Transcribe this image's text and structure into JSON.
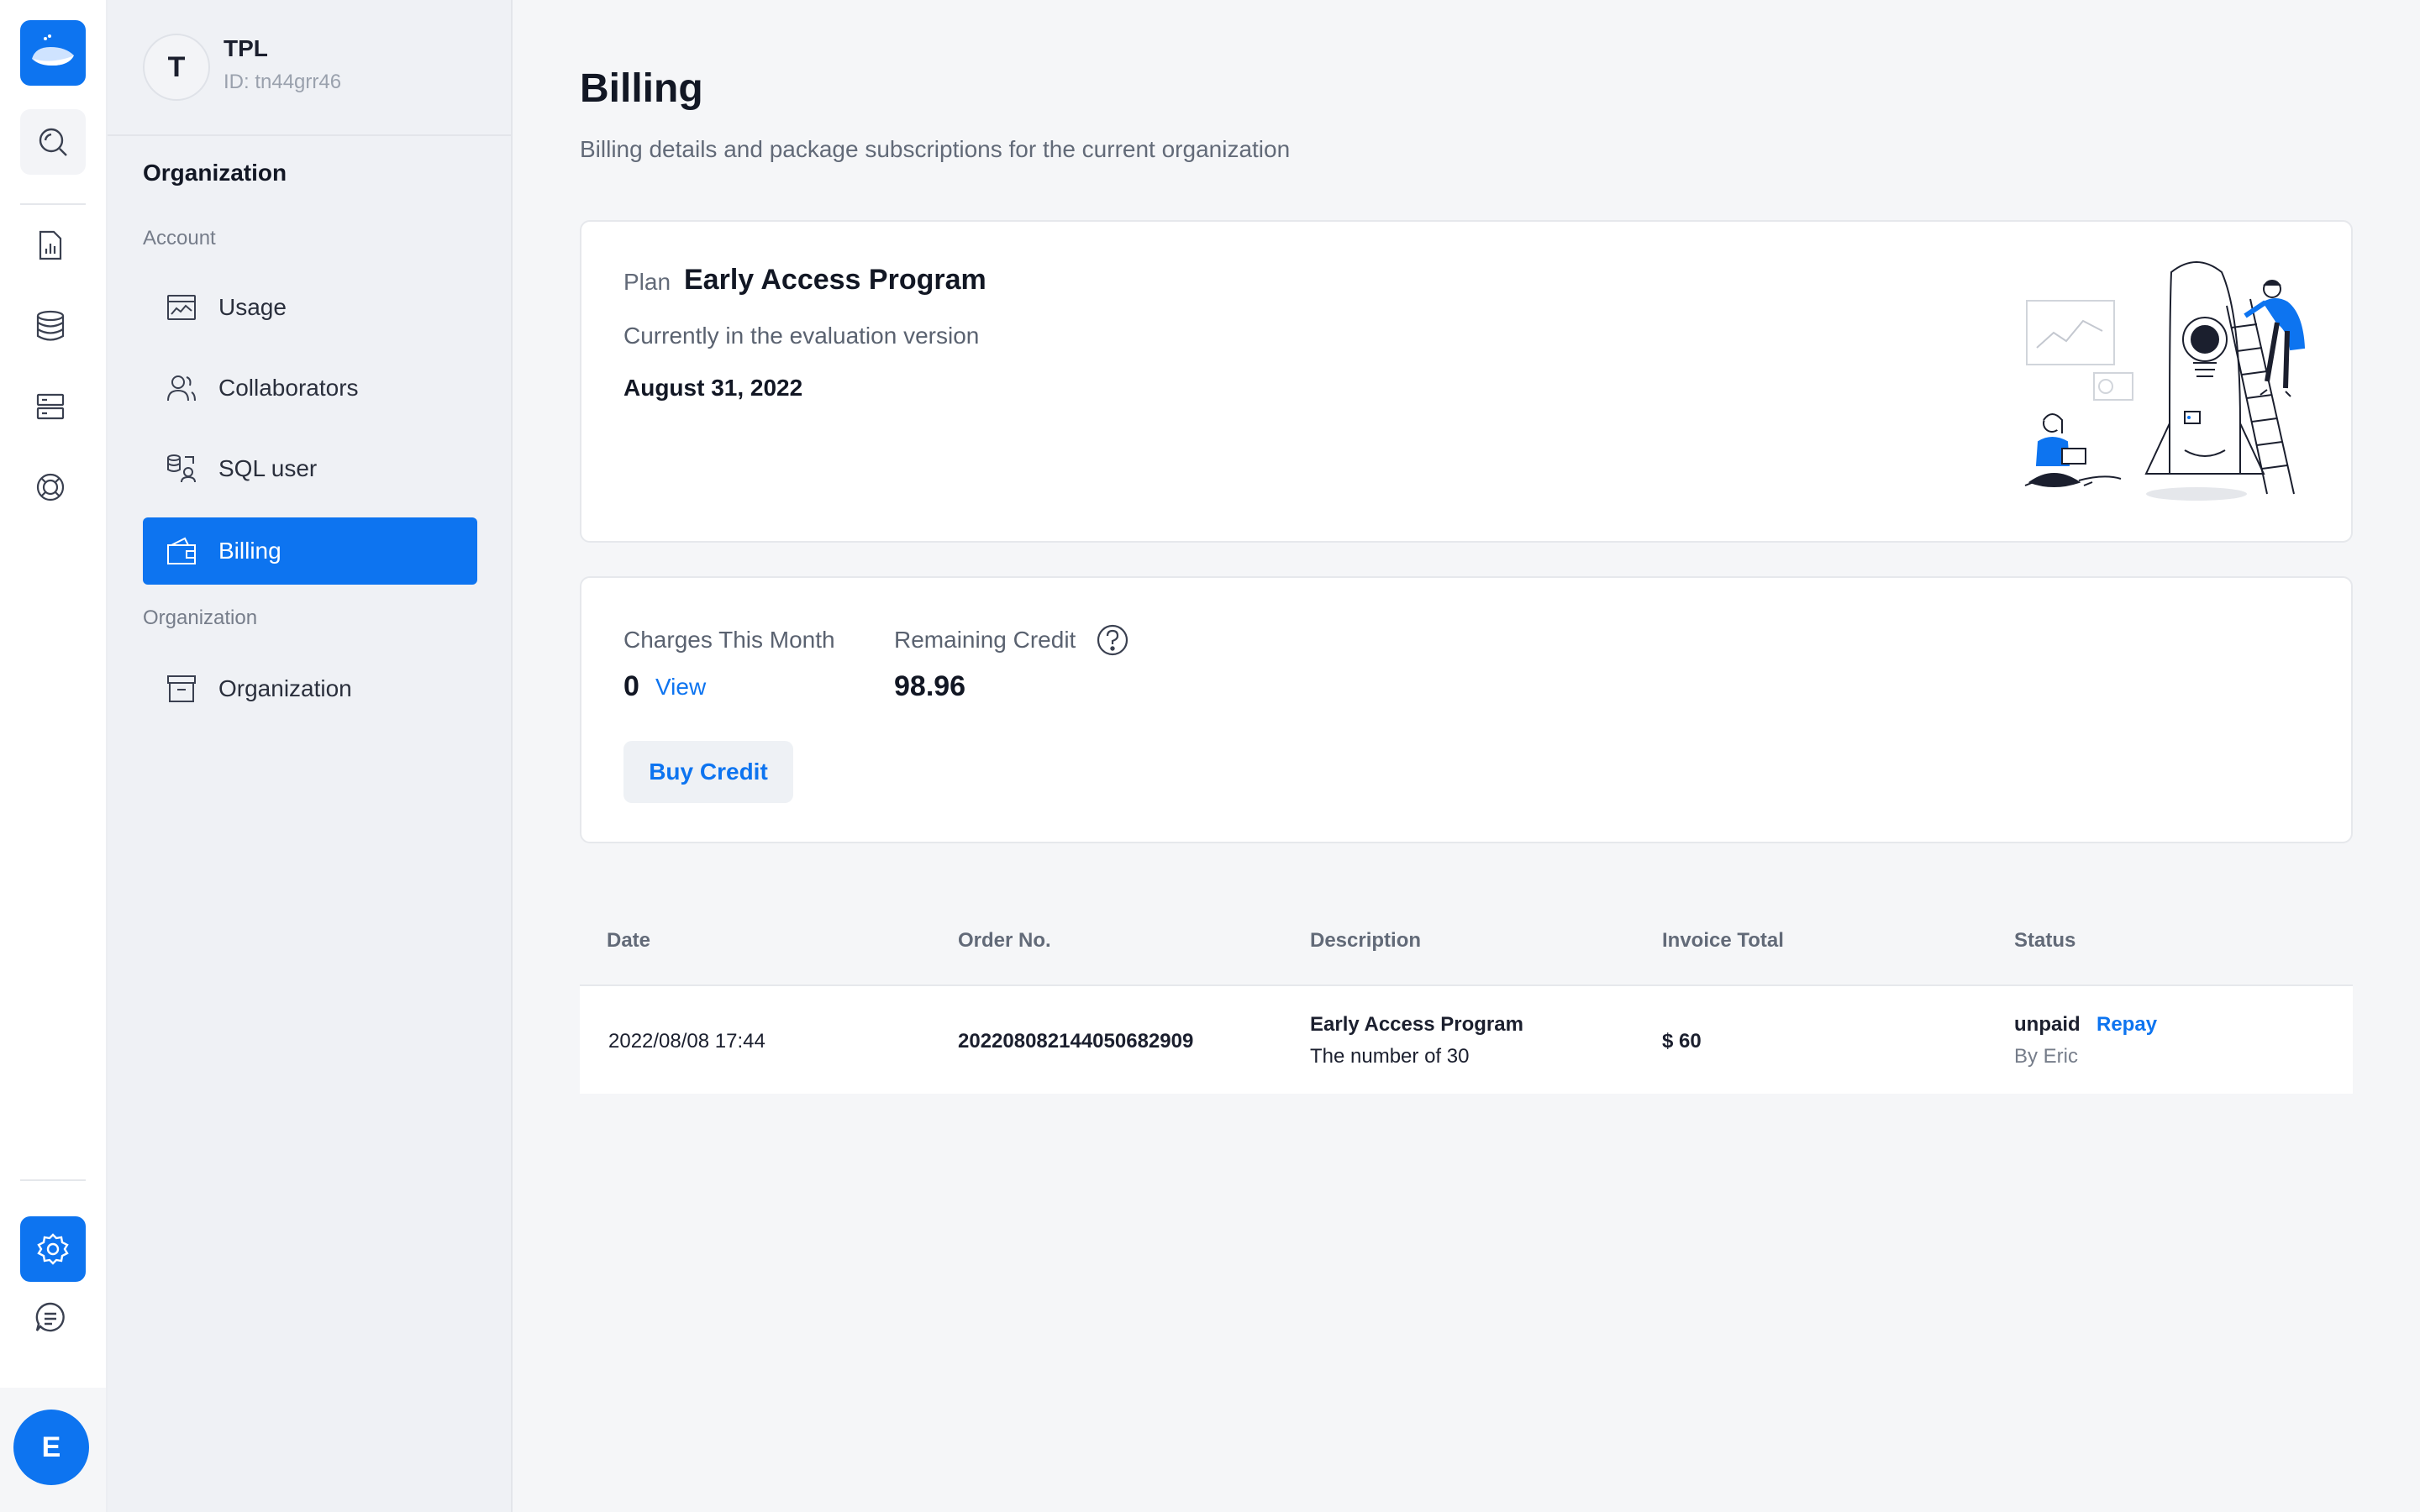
{
  "rail": {
    "items": [
      {
        "name": "search-icon"
      },
      {
        "name": "report-icon"
      },
      {
        "name": "database-icon"
      },
      {
        "name": "servers-icon"
      },
      {
        "name": "support-icon"
      },
      {
        "name": "gear-icon"
      },
      {
        "name": "chat-icon"
      }
    ],
    "avatar_letter": "E"
  },
  "org": {
    "avatar_letter": "T",
    "name": "TPL",
    "id": "ID: tn44grr46"
  },
  "sidebar": {
    "title": "Organization",
    "section_account": "Account",
    "section_organization": "Organization",
    "items": [
      {
        "label": "Usage",
        "icon": "usage-chart-icon"
      },
      {
        "label": "Collaborators",
        "icon": "users-icon"
      },
      {
        "label": "SQL user",
        "icon": "sql-user-icon"
      },
      {
        "label": "Billing",
        "icon": "wallet-icon",
        "active": true
      },
      {
        "label": "Organization",
        "icon": "building-icon"
      }
    ]
  },
  "page": {
    "title": "Billing",
    "subtitle": "Billing details and package subscriptions for the current organization"
  },
  "plan": {
    "label": "Plan",
    "name": "Early Access Program",
    "status": "Currently in the evaluation version",
    "date": "August 31, 2022"
  },
  "credit": {
    "charges_label": "Charges This Month",
    "charges_value": "0",
    "view_link": "View",
    "remaining_label": "Remaining Credit",
    "remaining_value": "98.96",
    "buy_button": "Buy Credit"
  },
  "table": {
    "headers": [
      "Date",
      "Order No.",
      "Description",
      "Invoice Total",
      "Status"
    ],
    "rows": [
      {
        "date": "2022/08/08 17:44",
        "order_no": "20220808214405068290​9",
        "description_title": "Early Access Program",
        "description_detail": "The number of 30",
        "total": "$ 60",
        "status": "unpaid",
        "action": "Repay",
        "by": "By Eric"
      }
    ]
  },
  "colors": {
    "accent": "#0d74f0",
    "background": "#f5f6f8",
    "sidebar": "#eff1f5"
  }
}
